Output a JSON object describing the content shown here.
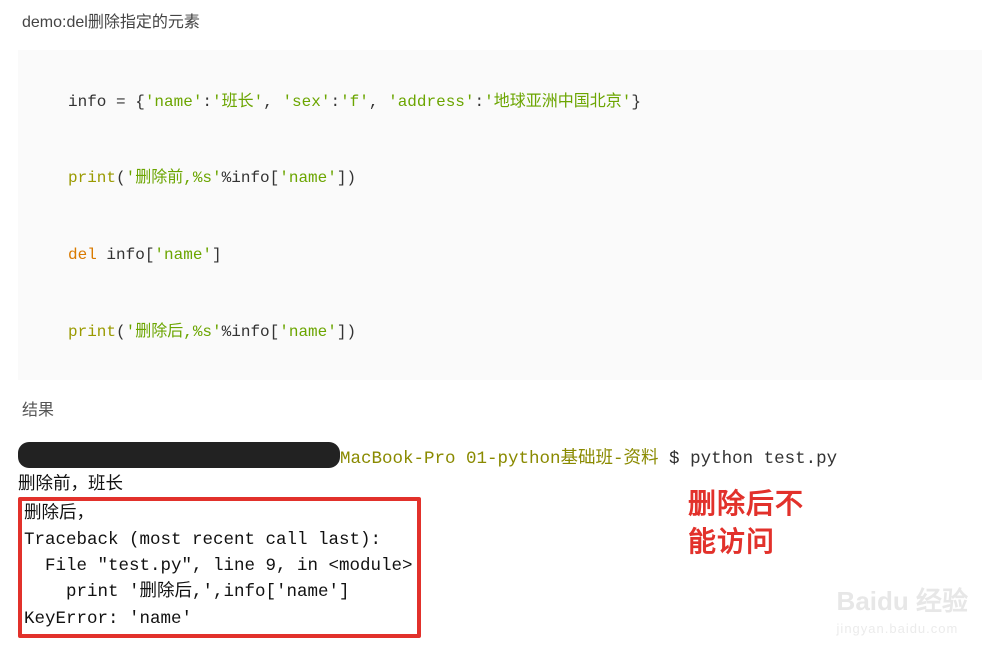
{
  "title": "demo:del删除指定的元素",
  "code": {
    "line1": {
      "prefix": "info = {",
      "k1": "'name'",
      "c1": ":",
      "v1": "'班长'",
      "sep1": ", ",
      "k2": "'sex'",
      "c2": ":",
      "v2": "'f'",
      "sep2": ", ",
      "k3": "'address'",
      "c3": ":",
      "v3": "'地球亚洲中国北京'",
      "suffix": "}"
    },
    "line2": {
      "fn": "print",
      "p1": "(",
      "s": "'删除前,%s'",
      "mid": "%info[",
      "k": "'name'",
      "p2": "])"
    },
    "line3": {
      "del": "del",
      "sp": " info[",
      "k": "'name'",
      "end": "]"
    },
    "line4": {
      "fn": "print",
      "p1": "(",
      "s": "'删除后,%s'",
      "mid": "%info[",
      "k": "'name'",
      "p2": "])"
    }
  },
  "result_label": "结果",
  "terminal": {
    "prompt_host": "MacBook-Pro 01-python基础班-资料",
    "dollar": " $ ",
    "command": "python test.py",
    "out1": "删除前，班长",
    "out2": "删除后，",
    "tb1": "Traceback (most recent call last):",
    "tb2": "  File \"test.py\", line 9, in <module>",
    "tb3": "    print '删除后,',info['name']",
    "tb4": "KeyError: 'name'"
  },
  "annotation": {
    "line1": "删除后不",
    "line2": "能访问"
  },
  "watermark": {
    "brand": "Baidu 经验",
    "url": "jingyan.baidu.com"
  }
}
